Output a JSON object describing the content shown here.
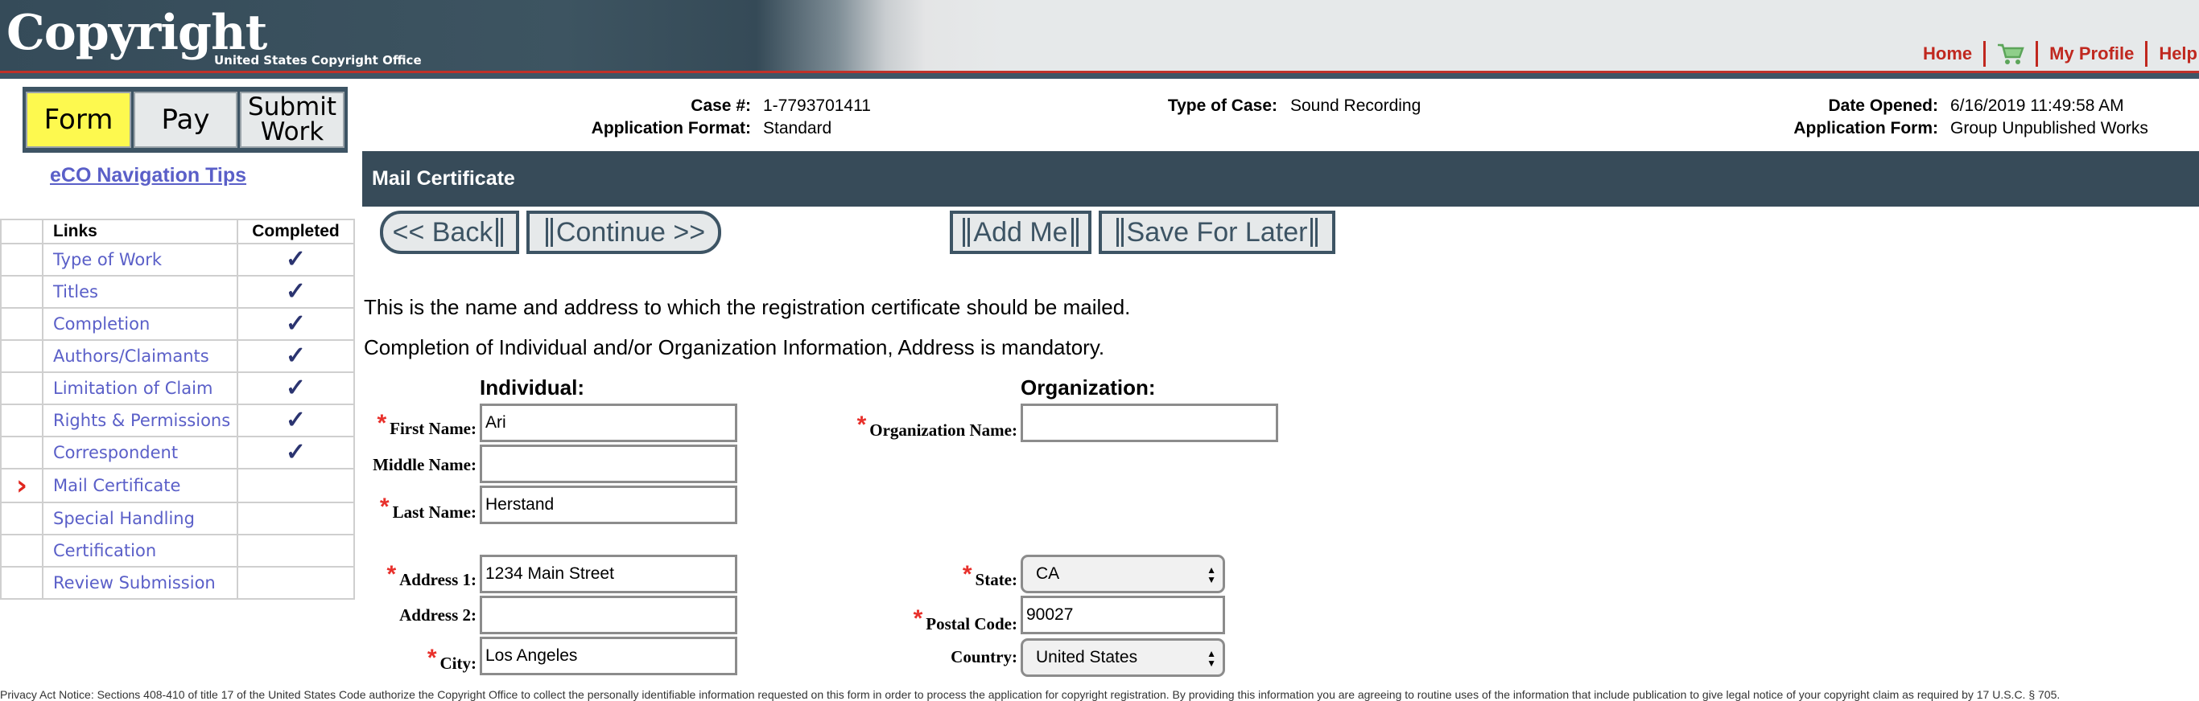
{
  "header": {
    "logo_word": "Copyright",
    "logo_sub": "United States Copyright Office",
    "links": {
      "home": "Home",
      "cart_icon": "cart-icon",
      "my_profile": "My Profile",
      "help": "Help"
    }
  },
  "phases": {
    "form": "Form",
    "pay": "Pay",
    "submit_line1": "Submit",
    "submit_line2": "Work",
    "active": "Form"
  },
  "nav_tips": "eCO Navigation Tips",
  "nav_table": {
    "headers": {
      "links": "Links",
      "completed": "Completed"
    },
    "rows": [
      {
        "label": "Type of Work",
        "completed": "✓",
        "current": ""
      },
      {
        "label": "Titles",
        "completed": "✓",
        "current": ""
      },
      {
        "label": "Completion",
        "completed": "✓",
        "current": ""
      },
      {
        "label": "Authors/Claimants",
        "completed": "✓",
        "current": ""
      },
      {
        "label": "Limitation of Claim",
        "completed": "✓",
        "current": ""
      },
      {
        "label": "Rights & Permissions",
        "completed": "✓",
        "current": ""
      },
      {
        "label": "Correspondent",
        "completed": "✓",
        "current": ""
      },
      {
        "label": "Mail Certificate",
        "completed": "",
        "current": "›"
      },
      {
        "label": "Special Handling",
        "completed": "",
        "current": ""
      },
      {
        "label": "Certification",
        "completed": "",
        "current": ""
      },
      {
        "label": "Review Submission",
        "completed": "",
        "current": ""
      }
    ]
  },
  "case_info": {
    "case_no_label": "Case #:",
    "case_no": "1-7793701411",
    "app_format_label": "Application Format:",
    "app_format": "Standard",
    "type_label": "Type of Case:",
    "type": "Sound Recording",
    "date_label": "Date Opened:",
    "date": "6/16/2019 11:49:58 AM",
    "app_form_label": "Application Form:",
    "app_form": "Group Unpublished Works"
  },
  "section_title": "Mail Certificate",
  "buttons": {
    "back": "<< Back",
    "continue": "Continue >>",
    "add_me": "Add Me",
    "save_later": "Save For Later"
  },
  "intro": [
    "This is the name and address to which the registration certificate should be mailed.",
    "Completion of Individual and/or Organization Information, Address is mandatory."
  ],
  "form": {
    "individual_heading": "Individual:",
    "organization_heading": "Organization:",
    "required_mark": "*",
    "first_name": {
      "label": "First Name:",
      "value": "Ari"
    },
    "middle_name": {
      "label": "Middle Name:",
      "value": ""
    },
    "last_name": {
      "label": "Last Name:",
      "value": "Herstand"
    },
    "organization_name": {
      "label": "Organization Name:",
      "value": ""
    },
    "address1": {
      "label": "Address 1:",
      "value": "1234 Main Street"
    },
    "address2": {
      "label": "Address 2:",
      "value": ""
    },
    "city": {
      "label": "City:",
      "value": "Los Angeles"
    },
    "state": {
      "label": "State:",
      "value": "CA"
    },
    "postal_code": {
      "label": "Postal Code:",
      "value": "90027"
    },
    "country": {
      "label": "Country:",
      "value": "United States"
    }
  },
  "privacy_notice": "Privacy Act Notice: Sections 408-410 of title 17 of the United States Code authorize the Copyright Office to collect the personally identifiable information requested on this form in order to process the application for copyright registration. By providing this information you are agreeing to routine uses of the information that include publication to give legal notice of your copyright claim as required by 17 U.S.C. § 705."
}
